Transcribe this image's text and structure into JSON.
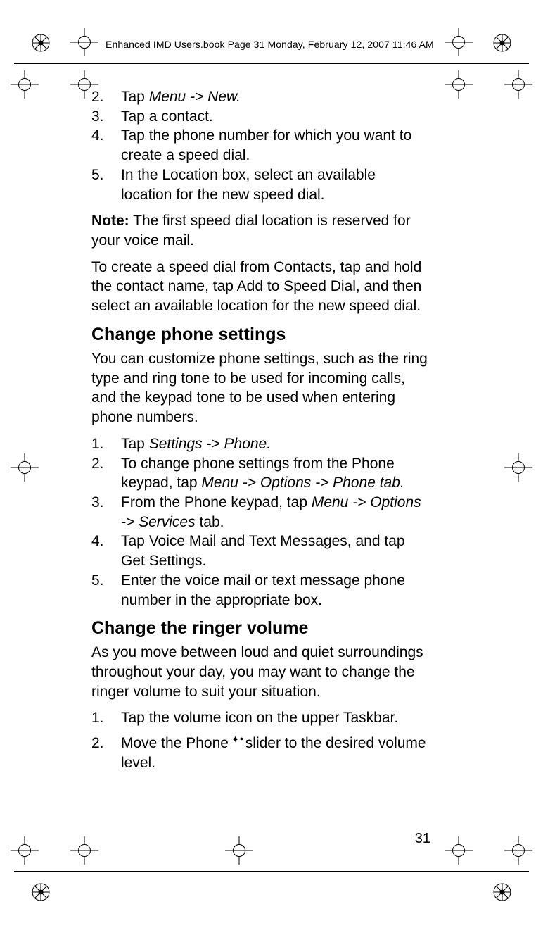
{
  "header": "Enhanced IMD Users.book  Page 31  Monday, February 12, 2007  11:46 AM",
  "page_number": "31",
  "list_a": {
    "i2": {
      "n": "2.",
      "t_a": "Tap ",
      "t_i": "Menu -> New.",
      "t_b": ""
    },
    "i3": {
      "n": "3.",
      "t": "Tap a contact."
    },
    "i4": {
      "n": "4.",
      "t": "Tap the phone number for which you want to create a speed dial."
    },
    "i5": {
      "n": "5.",
      "t": "In the Location box, select an available location for the new speed dial."
    }
  },
  "note_label": "Note:",
  "note_text": " The first speed dial location is reserved for your voice mail.",
  "para1": "To create a speed dial from Contacts, tap and hold the con­tact name, tap Add to Speed Dial, and then select an avail­able location for the new speed dial.",
  "h2a": "Change phone settings",
  "para2": "You can customize phone settings, such as the ring type and ring tone to be used for incoming calls, and the keypad tone to be used when entering phone numbers.",
  "list_b": {
    "i1": {
      "n": "1.",
      "t_a": "Tap ",
      "t_i": "Settings -> Phone.",
      "t_b": ""
    },
    "i2": {
      "n": "2.",
      "t_a": "To change phone settings from the Phone keypad, tap ",
      "t_i": "Menu -> Options -> Phone tab.",
      "t_b": ""
    },
    "i3": {
      "n": "3.",
      "t_a": "From the Phone keypad, tap ",
      "t_i": "Menu -> Options -> Services",
      "t_b": " tab."
    },
    "i4": {
      "n": "4.",
      "t": "Tap Voice Mail and Text Messages, and tap Get Set­tings."
    },
    "i5": {
      "n": "5.",
      "t": "Enter the voice mail or text message phone number in the appropriate box."
    }
  },
  "h2b": "Change the ringer volume",
  "para3": "As you move between loud and quiet surroundings through­out your day, you may want to change the ringer volume to suit your situation.",
  "list_c": {
    "i1": {
      "n": "1.",
      "t": "Tap the volume icon on the upper Taskbar."
    },
    "i2": {
      "n": "2.",
      "t_a": "Move the Phone ",
      "t_b": "slider to the desired volume level."
    }
  }
}
